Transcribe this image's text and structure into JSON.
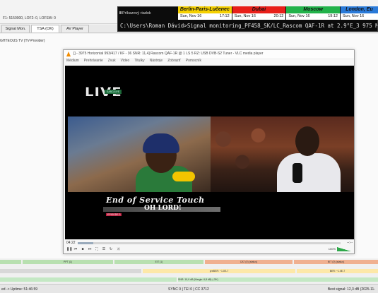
{
  "app": {
    "status_line": "F1: 5150000, LOF2: 0, LOFSW: 0",
    "provider_line": "GHTEOUS TV (TV-Provider)",
    "tabs": [
      {
        "label": "Signal Mon."
      },
      {
        "label": "TSA (OK)",
        "active": true
      },
      {
        "label": "AV Player"
      }
    ]
  },
  "cmd": {
    "title": "Príkazový riadok",
    "text": "C:\\Users\\Roman Dávid>Signal monitoring_PF458_SK/LC_Rascom QAF-1R at 2.9°E_3 975 MHz My Ri"
  },
  "clocks": [
    {
      "city": "Berlin-Paris-Lučenec",
      "date": "Sun, Nov 16",
      "time": "17:12",
      "color": "#f5d000"
    },
    {
      "city": "Dubai",
      "date": "Sun, Nov 16",
      "time": "20:12",
      "color": "#e8201a"
    },
    {
      "city": "Moscow",
      "date": "Sun, Nov 16",
      "time": "19:12",
      "color": "#22b24a"
    },
    {
      "city": "London, Eu",
      "date": "Sun, Nov 16",
      "time": "",
      "color": "#2a7ad8"
    }
  ],
  "vlc": {
    "title": "[] - 3975 Horizontal 993/417 / KF - 36 SNR: 11,4] Rascom QAF-1R @ 1 LS 5 RZ: USB DVB-S2 Tuner - VLC media player",
    "menu": [
      "Médium",
      "Prehrávanie",
      "Zvuk",
      "Video",
      "Titulky",
      "Nástroje",
      "Zobraziť",
      "Pomocník"
    ],
    "logo": "LIVE",
    "logo_sub": "SABC/LIVE",
    "caption_line1": "End of Service Touch",
    "caption_line2": "OH LORD!",
    "caption_tag": "EPISODE 3",
    "time_elapsed": "04:22",
    "time_total": "--:--",
    "volume_pct": "100%",
    "seek_fraction": 0.06
  },
  "meters": {
    "row1": [
      "PPT (1)",
      "EIT (1)",
      "CAT (0) (status)",
      "NIT (0) (status)"
    ],
    "row2_left": "preBER: ~1.0E-7",
    "row2_right": "BER: ~1.0E-7",
    "row3": "SNR: 10,9 dB (Margin: 6,8 dB) ( OK)"
  },
  "bottom": {
    "left": "ed -> Uptime: 51:46:59",
    "mid": "SYNC 0 | TEI 0 | CC 3712",
    "right": "Best signal: 12,3 dB (2025-11-"
  }
}
